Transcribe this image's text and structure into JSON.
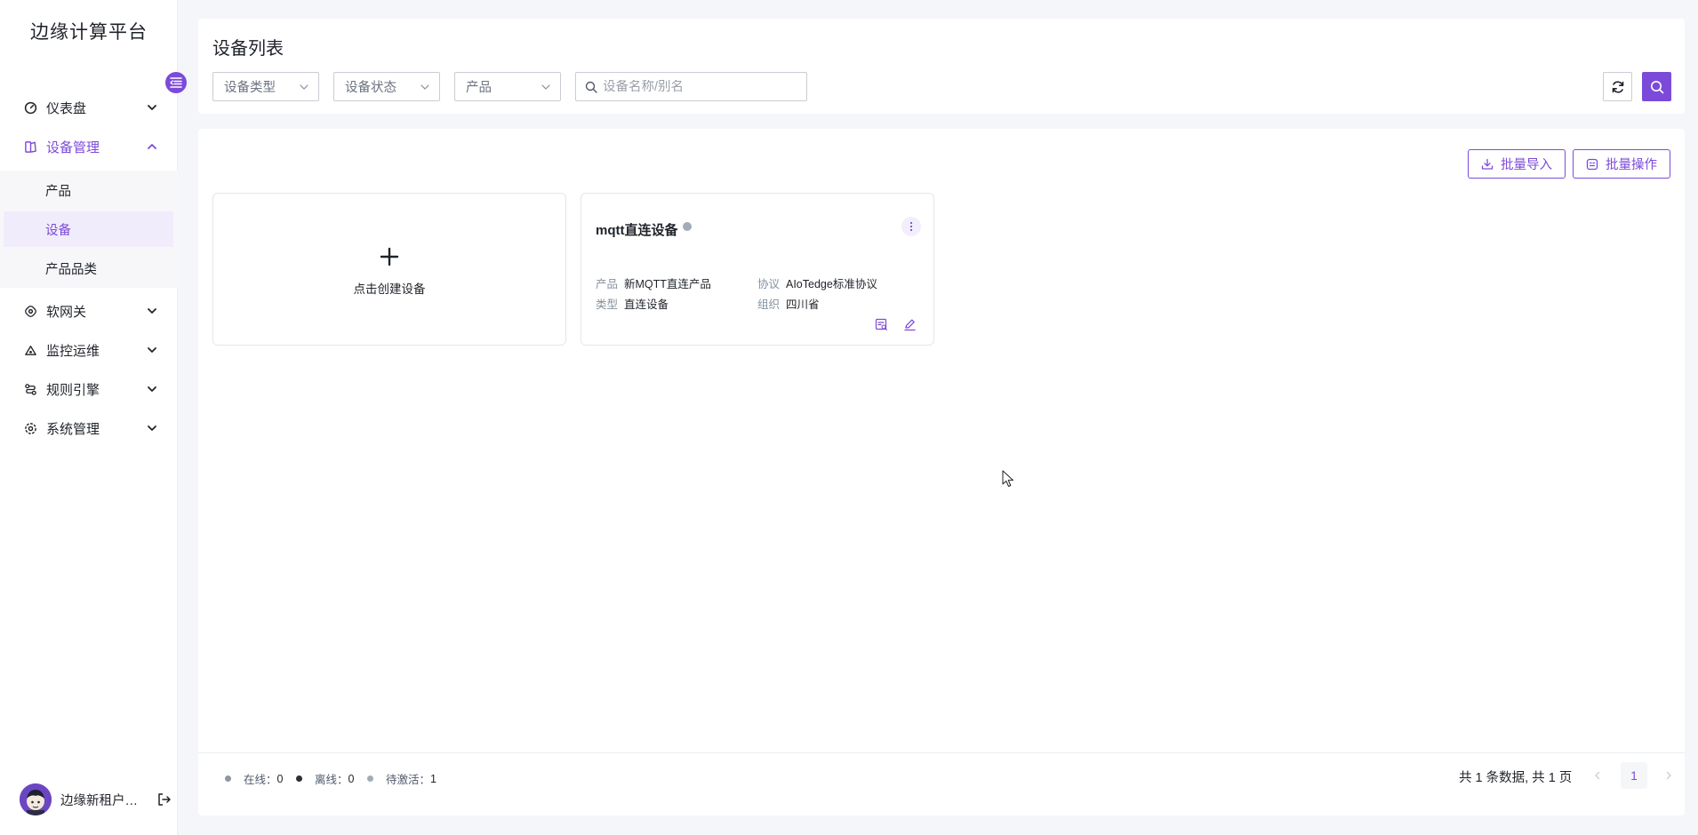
{
  "app": {
    "title": "边缘计算平台"
  },
  "sidebar": {
    "items": [
      {
        "label": "仪表盘",
        "icon": "dashboard-icon"
      },
      {
        "label": "设备管理",
        "icon": "device-management-icon",
        "expanded": true,
        "children": [
          {
            "label": "产品"
          },
          {
            "label": "设备",
            "active": true
          },
          {
            "label": "产品品类"
          }
        ]
      },
      {
        "label": "软网关",
        "icon": "gateway-icon"
      },
      {
        "label": "监控运维",
        "icon": "monitor-icon"
      },
      {
        "label": "规则引擎",
        "icon": "rule-engine-icon"
      },
      {
        "label": "系统管理",
        "icon": "settings-icon"
      }
    ],
    "user": {
      "name": "边缘新租户管…"
    }
  },
  "header": {
    "title": "设备列表",
    "filters": {
      "device_type": "设备类型",
      "device_status": "设备状态",
      "product": "产品"
    },
    "search": {
      "placeholder": "设备名称/别名",
      "value": ""
    }
  },
  "toolbar": {
    "import_label": "批量导入",
    "batch_label": "批量操作"
  },
  "create_card": {
    "label": "点击创建设备"
  },
  "devices": [
    {
      "name": "mqtt直连设备",
      "status": "待激活",
      "product_label": "产品",
      "product": "新MQTT直连产品",
      "protocol_label": "协议",
      "protocol": "AIoTedge标准协议",
      "type_label": "类型",
      "type": "直连设备",
      "org_label": "组织",
      "org": "四川省"
    }
  ],
  "footer": {
    "online_label": "在线：",
    "online_count": "0",
    "offline_label": "离线：",
    "offline_count": "0",
    "pending_label": "待激活：",
    "pending_count": "1",
    "total_text": "共 1 条数据, 共 1 页",
    "current_page": "1"
  },
  "colors": {
    "accent": "#7c4ad9",
    "online_dot": "#8f96a3",
    "offline_dot": "#2b2f36",
    "pending_dot": "#a4abb8"
  }
}
